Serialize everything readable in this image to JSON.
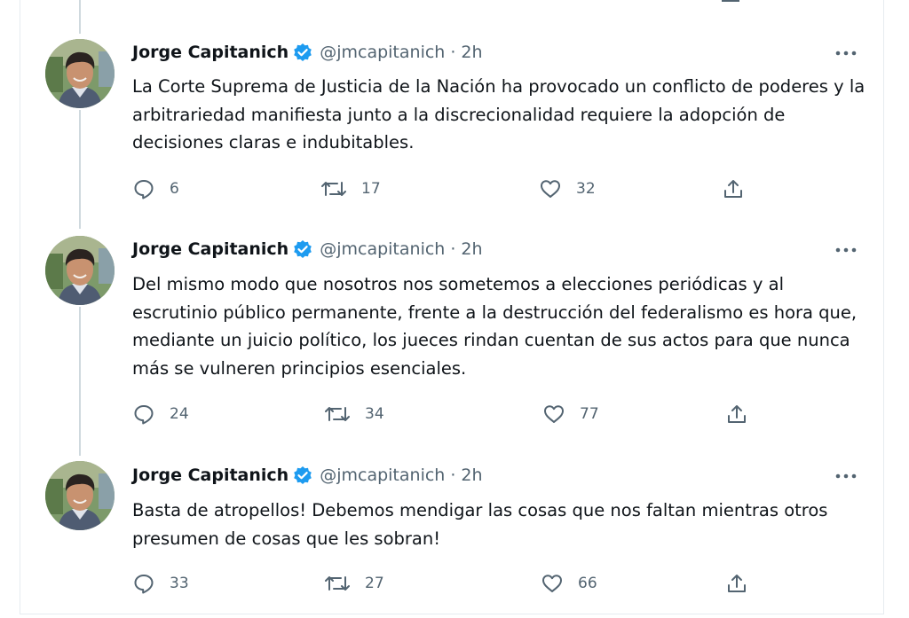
{
  "tweets": [
    {
      "author": "Jorge Capitanich",
      "handle": "@jmcapitanich",
      "separator": "·",
      "time": "2h",
      "text": "La Corte Suprema de Justicia de la Nación ha provocado un conflicto de poderes y la arbitrariedad manifiesta junto a la discrecionalidad requiere la adopción de decisiones claras e indubitables.",
      "replies": "6",
      "retweets": "17",
      "likes": "32"
    },
    {
      "author": "Jorge Capitanich",
      "handle": "@jmcapitanich",
      "separator": "·",
      "time": "2h",
      "text": "Del mismo modo que nosotros nos sometemos a elecciones periódicas y al escrutinio público permanente, frente a la destrucción del federalismo es hora que, mediante un juicio político, los jueces rindan cuentan de sus actos para que nunca más se vulneren principios esenciales.",
      "replies": "24",
      "retweets": "34",
      "likes": "77"
    },
    {
      "author": "Jorge Capitanich",
      "handle": "@jmcapitanich",
      "separator": "·",
      "time": "2h",
      "text": "Basta de atropellos! Debemos mendigar las cosas que nos faltan mientras otros presumen de cosas que les sobran!",
      "replies": "33",
      "retweets": "27",
      "likes": "66"
    }
  ],
  "icons": {
    "verified": "verified-badge-icon",
    "more": "more-options-icon",
    "reply": "reply-icon",
    "retweet": "retweet-icon",
    "like": "like-icon",
    "share": "share-icon"
  },
  "colors": {
    "verified_blue": "#1d9bf0",
    "secondary_text": "#536471",
    "primary_text": "#0f1419",
    "thread_line": "#cfd9de"
  }
}
